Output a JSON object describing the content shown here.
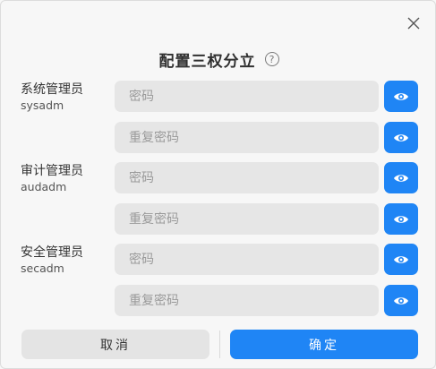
{
  "dialog": {
    "title": "配置三权分立",
    "help_symbol": "?",
    "close_icon": "close-icon"
  },
  "groups": [
    {
      "name": "系统管理员",
      "id": "sysadm"
    },
    {
      "name": "审计管理员",
      "id": "audadm"
    },
    {
      "name": "安全管理员",
      "id": "secadm"
    }
  ],
  "fields": [
    {
      "placeholder": "密码",
      "value": ""
    },
    {
      "placeholder": "重复密码",
      "value": ""
    },
    {
      "placeholder": "密码",
      "value": ""
    },
    {
      "placeholder": "重复密码",
      "value": ""
    },
    {
      "placeholder": "密码",
      "value": ""
    },
    {
      "placeholder": "重复密码",
      "value": ""
    }
  ],
  "buttons": {
    "cancel": "取消",
    "confirm": "确定"
  },
  "colors": {
    "accent": "#1f85f5",
    "field_bg": "#e6e6e6",
    "background": "#f7f7f7"
  }
}
